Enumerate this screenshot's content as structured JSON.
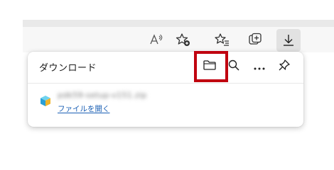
{
  "toolbar": {
    "read_aloud_icon": "read-aloud-icon",
    "add_favorite_icon": "add-favorite-icon",
    "favorites_icon": "favorites-icon",
    "collections_icon": "collections-icon",
    "downloads_icon": "download-icon"
  },
  "downloads_panel": {
    "title": "ダウンロード",
    "actions": [
      "folder-icon",
      "search-icon",
      "more-icon",
      "pin-icon"
    ],
    "items": [
      {
        "file_name": "pdk59-setup-v151.zip",
        "link_label": "ファイルを開く",
        "icon": "package-icon"
      }
    ]
  },
  "colors": {
    "highlight": "#c0000f",
    "link": "#1a5fb4",
    "toolbar_bg": "#f7f7f7"
  }
}
